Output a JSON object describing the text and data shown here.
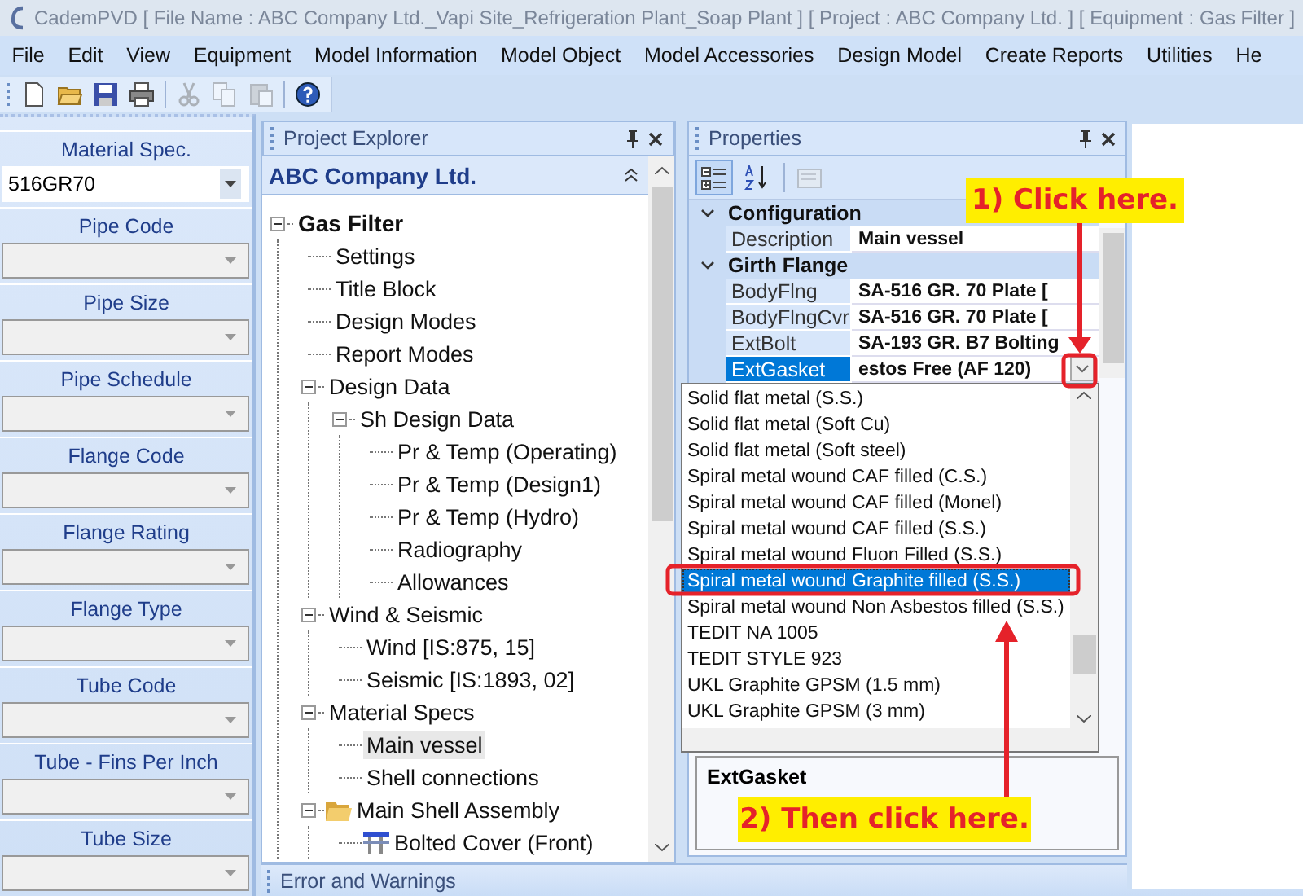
{
  "window": {
    "title": "CademPVD [ File Name : ABC Company Ltd._Vapi Site_Refrigeration Plant_Soap Plant ] [ Project : ABC Company Ltd. ] [ Equipment : Gas Filter ]"
  },
  "menu": [
    "File",
    "Edit",
    "View",
    "Equipment",
    "Model Information",
    "Model Object",
    "Model Accessories",
    "Design Model",
    "Create Reports",
    "Utilities",
    "He"
  ],
  "toolbar": [
    {
      "kind": "new",
      "disabled": false
    },
    {
      "kind": "open",
      "disabled": false
    },
    {
      "kind": "save",
      "disabled": false
    },
    {
      "kind": "print",
      "disabled": false
    },
    {
      "kind": "cut",
      "disabled": true
    },
    {
      "kind": "copy",
      "disabled": true
    },
    {
      "kind": "paste",
      "disabled": true
    },
    {
      "kind": "help",
      "disabled": false
    }
  ],
  "spec_panel": {
    "fields": [
      {
        "label": "Material Spec.",
        "value": "516GR70",
        "disabled": false
      },
      {
        "label": "Pipe Code",
        "disabled": true
      },
      {
        "label": "Pipe Size",
        "disabled": true
      },
      {
        "label": "Pipe Schedule",
        "disabled": true
      },
      {
        "label": "Flange Code",
        "disabled": true
      },
      {
        "label": "Flange Rating",
        "disabled": true
      },
      {
        "label": "Flange Type",
        "disabled": true
      },
      {
        "label": "Tube Code",
        "disabled": true
      },
      {
        "label": "Tube - Fins Per Inch",
        "disabled": true
      },
      {
        "label": "Tube Size",
        "disabled": true
      }
    ]
  },
  "project_explorer": {
    "title": "Project Explorer",
    "group": "ABC Company Ltd.",
    "tree": [
      {
        "label": "Gas Filter",
        "expanded": true,
        "selected": false,
        "children": [
          {
            "label": "Settings",
            "selected": false
          },
          {
            "label": "Title Block",
            "selected": false
          },
          {
            "label": "Design Modes",
            "selected": false
          },
          {
            "label": "Report Modes",
            "selected": false
          },
          {
            "label": "Design Data",
            "expanded": true,
            "selected": false,
            "children": [
              {
                "label": "Sh Design Data",
                "expanded": true,
                "selected": false,
                "children": [
                  {
                    "label": "Pr & Temp (Operating)",
                    "selected": false
                  },
                  {
                    "label": "Pr & Temp (Design1)",
                    "selected": false
                  },
                  {
                    "label": "Pr & Temp (Hydro)",
                    "selected": false
                  },
                  {
                    "label": "Radiography",
                    "selected": false
                  },
                  {
                    "label": "Allowances",
                    "selected": false
                  }
                ]
              }
            ]
          },
          {
            "label": "Wind & Seismic",
            "expanded": true,
            "selected": false,
            "children": [
              {
                "label": "Wind [IS:875, 15]",
                "selected": false
              },
              {
                "label": "Seismic [IS:1893, 02]",
                "selected": false
              }
            ]
          },
          {
            "label": "Material Specs",
            "expanded": true,
            "selected": false,
            "children": [
              {
                "label": "Main vessel",
                "selected": true
              },
              {
                "label": "Shell connections",
                "selected": false
              }
            ]
          },
          {
            "label": "Main Shell Assembly",
            "kind": "folder",
            "expanded": true,
            "selected": false,
            "children": [
              {
                "label": "Bolted Cover (Front)",
                "kind": "cover",
                "selected": false
              }
            ]
          }
        ]
      }
    ]
  },
  "properties": {
    "title": "Properties",
    "toolbar": [
      {
        "kind": "categorized",
        "selected": true,
        "disabled": false
      },
      {
        "kind": "alphabetical",
        "selected": false,
        "disabled": false
      },
      {
        "kind": "pages",
        "selected": false,
        "disabled": true
      }
    ],
    "categories": [
      {
        "name": "Configuration",
        "expanded": true,
        "rows": [
          {
            "name": "Description",
            "value": "Main vessel",
            "selected": false
          }
        ]
      },
      {
        "name": "Girth Flange",
        "expanded": true,
        "rows": [
          {
            "name": "BodyFlng",
            "value": "SA-516 GR. 70 Plate [",
            "selected": false
          },
          {
            "name": "BodyFlngCvr",
            "value": "SA-516 GR. 70 Plate [",
            "selected": false
          },
          {
            "name": "ExtBolt",
            "value": "SA-193 GR. B7 Bolting",
            "selected": false
          },
          {
            "name": "ExtGasket",
            "value": "estos Free (AF 120)",
            "selected": true
          }
        ]
      }
    ],
    "dropdown": {
      "items": [
        {
          "label": "Solid flat metal (S.S.)",
          "selected": false
        },
        {
          "label": "Solid flat metal (Soft Cu)",
          "selected": false
        },
        {
          "label": "Solid flat metal (Soft steel)",
          "selected": false
        },
        {
          "label": "Spiral metal wound CAF filled (C.S.)",
          "selected": false
        },
        {
          "label": "Spiral metal wound CAF filled (Monel)",
          "selected": false
        },
        {
          "label": "Spiral metal wound CAF filled (S.S.)",
          "selected": false
        },
        {
          "label": "Spiral metal wound Fluon Filled (S.S.)",
          "selected": false
        },
        {
          "label": "Spiral metal wound Graphite filled (S.S.)",
          "selected": true
        },
        {
          "label": "Spiral metal wound Non Asbestos filled (S.S.)",
          "selected": false
        },
        {
          "label": "TEDIT NA 1005",
          "selected": false
        },
        {
          "label": "TEDIT STYLE 923",
          "selected": false
        },
        {
          "label": "UKL Graphite GPSM (1.5 mm)",
          "selected": false
        },
        {
          "label": "UKL Graphite GPSM (3 mm)",
          "selected": false
        }
      ]
    },
    "description": {
      "title": "ExtGasket"
    }
  },
  "error_panel": {
    "title": "Error and Warnings"
  },
  "callouts": [
    {
      "text": "1) Click here."
    },
    {
      "text": "2) Then click here."
    }
  ]
}
